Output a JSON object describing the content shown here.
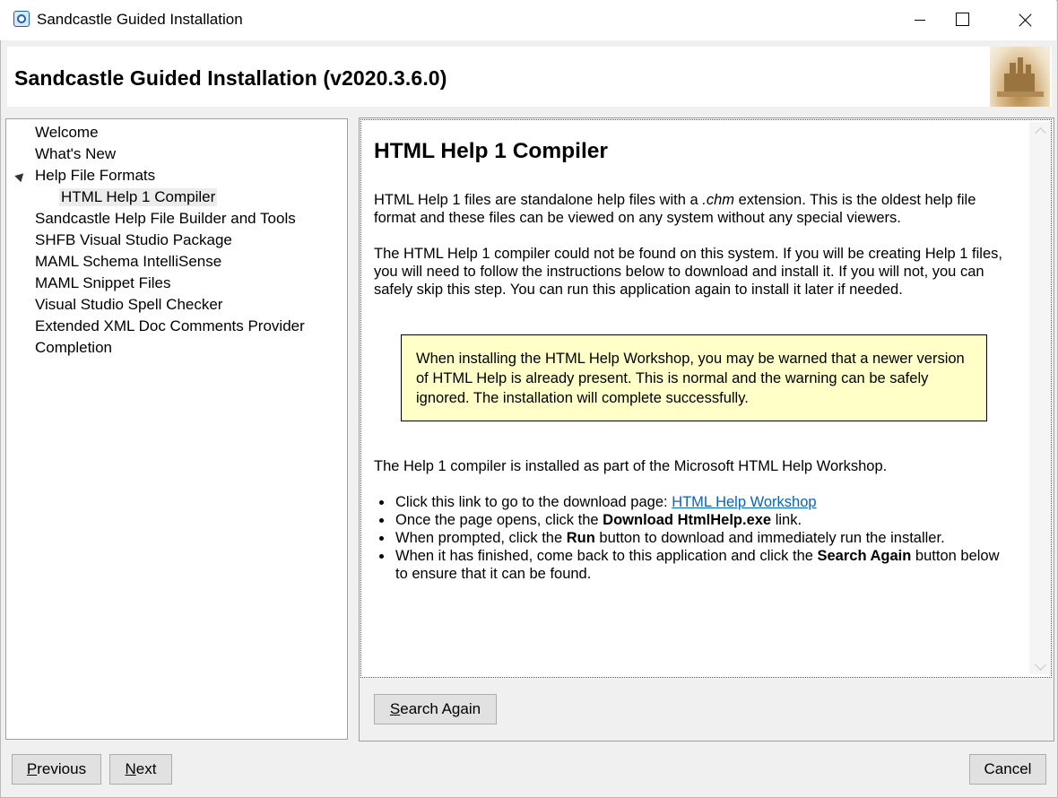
{
  "window": {
    "title": "Sandcastle Guided Installation"
  },
  "banner": {
    "title": "Sandcastle Guided Installation (v2020.3.6.0)"
  },
  "nav": {
    "items": [
      {
        "label": "Welcome"
      },
      {
        "label": "What's New"
      },
      {
        "label": "Help File Formats",
        "expanded": true
      },
      {
        "label": "HTML Help 1 Compiler",
        "selected": true
      },
      {
        "label": "Sandcastle Help File Builder and Tools"
      },
      {
        "label": "SHFB Visual Studio Package"
      },
      {
        "label": "MAML Schema IntelliSense"
      },
      {
        "label": "MAML Snippet Files"
      },
      {
        "label": "Visual Studio Spell Checker"
      },
      {
        "label": "Extended XML Doc Comments Provider"
      },
      {
        "label": "Completion"
      }
    ]
  },
  "content": {
    "heading": "HTML Help 1 Compiler",
    "para1": {
      "before": "HTML Help 1 files are standalone help files with a ",
      "ext": ".chm",
      "after": " extension. This is the oldest help file format and these files can be viewed on any system without any special viewers."
    },
    "para2": "The HTML Help 1 compiler could not be found on this system. If you will be creating Help 1 files, you will need to follow the instructions below to download and install it. If you will not, you can safely skip this step. You can run this application again to install it later if needed.",
    "note": "When installing the HTML Help Workshop, you may be warned that a newer version of HTML Help is already present. This is normal and the warning can be safely ignored. The installation will complete successfully.",
    "para3": "The Help 1 compiler is installed as part of the Microsoft HTML Help Workshop.",
    "steps": {
      "s1_text": "Click this link to go to the download page: ",
      "s1_link": "HTML Help Workshop",
      "s2_before": "Once the page opens, click the ",
      "s2_bold": "Download HtmlHelp.exe",
      "s2_after": " link.",
      "s3_before": "When prompted, click the ",
      "s3_bold": "Run",
      "s3_after": " button to download and immediately run the installer.",
      "s4_before": "When it has finished, come back to this application and click the ",
      "s4_bold": "Search Again",
      "s4_after": " button below to ensure that it can be found."
    }
  },
  "buttons": {
    "search_again": {
      "mnemonic": "S",
      "rest": "earch Again"
    },
    "previous": {
      "mnemonic": "P",
      "rest": "revious"
    },
    "next": {
      "mnemonic": "N",
      "rest": "ext"
    },
    "cancel": "Cancel"
  },
  "icons": {
    "app": "help-question-icon",
    "banner": "sandcastle-image"
  }
}
